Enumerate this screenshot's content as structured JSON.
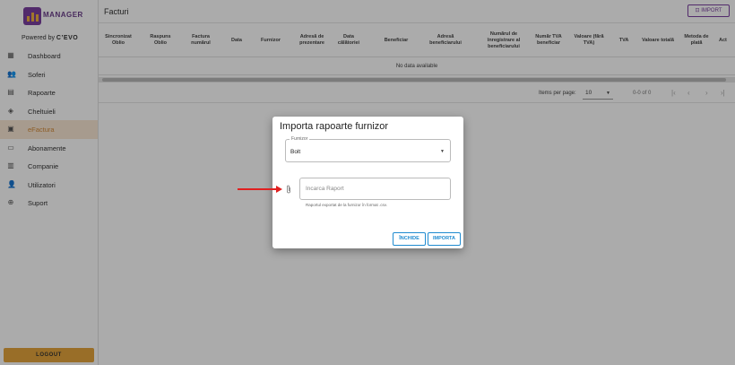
{
  "sidebar": {
    "logo_text": "MANAGER",
    "powered_by": "Powered by",
    "powered_brand": "C’EVO",
    "items": [
      {
        "label": "Dashboard",
        "icon": "dashboard-icon"
      },
      {
        "label": "Soferi",
        "icon": "drivers-icon"
      },
      {
        "label": "Rapoarte",
        "icon": "reports-icon"
      },
      {
        "label": "Cheltuieli",
        "icon": "expenses-icon"
      },
      {
        "label": "eFactura",
        "icon": "invoice-icon",
        "active": true
      },
      {
        "label": "Abonamente",
        "icon": "subscriptions-icon"
      },
      {
        "label": "Companie",
        "icon": "company-icon"
      },
      {
        "label": "Utilizatori",
        "icon": "users-icon"
      },
      {
        "label": "Suport",
        "icon": "support-icon"
      }
    ],
    "logout": "LOGOUT"
  },
  "header": {
    "title": "Facturi",
    "import_button": "IMPORT"
  },
  "table": {
    "columns": [
      "Sincronizat Oblio",
      "Raspuns Oblio",
      "Factura numărul",
      "Data",
      "Furnizor",
      "Adresă de prezentare",
      "Data călătoriei",
      "Beneficiar",
      "Adresă beneficiarului",
      "Numărul de înregistrare al beneficiarului",
      "Număr TVA beneficiar",
      "Valoare (fără TVA)",
      "TVA",
      "Valoare totală",
      "Metoda de plată",
      "Act"
    ],
    "empty_message": "No data available"
  },
  "pagination": {
    "items_per_page_label": "Items per page:",
    "items_per_page_value": "10",
    "range": "0-0 of 0"
  },
  "dialog": {
    "title": "Importa rapoarte furnizor",
    "supplier_label": "Furnizor",
    "supplier_value": "Bolt",
    "upload_placeholder": "Incarca Raport",
    "hint": "Raportul exportat de la furnizor în format .csv.",
    "close_button": "ÎNCHIDE",
    "import_button": "IMPORTA"
  },
  "colors": {
    "brand_purple": "#7b3fa0",
    "accent_orange": "#e4a53c",
    "button_blue": "#1f8bd0",
    "annotation_red": "#e02020"
  }
}
